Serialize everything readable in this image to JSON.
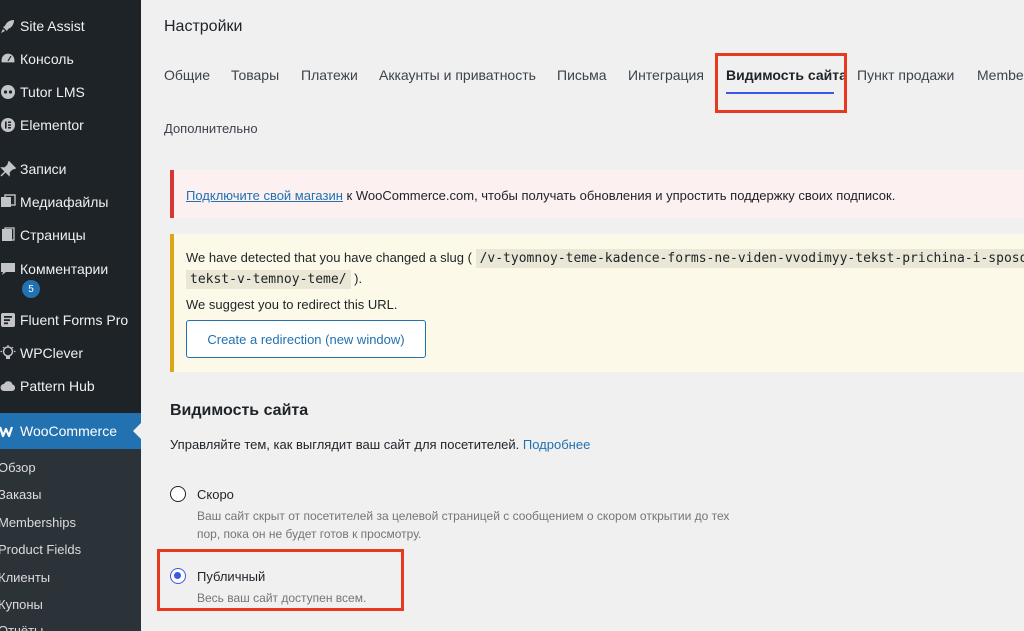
{
  "sidebar": {
    "items": [
      {
        "label": "Site Assist",
        "icon": "rocket-icon"
      },
      {
        "label": "Консоль",
        "icon": "dashboard-icon"
      },
      {
        "label": "Tutor LMS",
        "icon": "tutor-icon"
      },
      {
        "label": "Elementor",
        "icon": "elementor-icon"
      },
      {
        "label": "Записи",
        "icon": "pin-icon"
      },
      {
        "label": "Медиафайлы",
        "icon": "media-icon"
      },
      {
        "label": "Страницы",
        "icon": "page-icon"
      },
      {
        "label": "Комментарии",
        "icon": "comment-icon"
      },
      {
        "label": "Fluent Forms Pro",
        "icon": "forms-icon"
      },
      {
        "label": "WPClever",
        "icon": "bulb-icon"
      },
      {
        "label": "Pattern Hub",
        "icon": "cloud-icon"
      }
    ],
    "comments_badge": "5",
    "active": {
      "label": "WooCommerce",
      "icon": "woo-icon"
    },
    "submenu": [
      "Обзор",
      "Заказы",
      "Memberships",
      "Product Fields",
      "Клиенты",
      "Купоны",
      "Отчёты"
    ]
  },
  "page": {
    "title": "Настройки",
    "tabs": [
      "Общие",
      "Товары",
      "Платежи",
      "Аккаунты и приватность",
      "Письма",
      "Интеграция",
      "Видимость сайта",
      "Пункт продажи",
      "Membe",
      "Дополнительно"
    ],
    "active_tab": "Видимость сайта"
  },
  "notices": {
    "connect": {
      "link": "Подключите свой магазин",
      "text": " к WooCommerce.com, чтобы получать обновления и упростить поддержку своих подписок."
    },
    "slug": {
      "line1_prefix": "We have detected that you have changed a slug ( ",
      "slug_part1": "/v-tyomnoy-teme-kadence-forms-ne-viden-vvodimyy-tekst-prichina-i-sposoby",
      "slug_part2": "tekst-v-temnoy-teme/",
      "line2_suffix": " ).",
      "line3": "We suggest you to redirect this URL.",
      "button": "Create a redirection (new window)"
    }
  },
  "visibility": {
    "title": "Видимость сайта",
    "desc": "Управляйте тем, как выглядит ваш сайт для посетителей. ",
    "more_link": "Подробнее",
    "options": [
      {
        "label": "Скоро",
        "help_line1": "Ваш сайт скрыт от посетителей за целевой страницей с сообщением о скором открытии до тех",
        "help_line2": "пор, пока он не будет готов к просмотру.",
        "selected": false
      },
      {
        "label": "Публичный",
        "help_line1": "Весь ваш сайт доступен всем.",
        "selected": true
      }
    ]
  },
  "colors": {
    "accent": "#3858e9",
    "highlight": "#e6391f",
    "sidebar_bg": "#1d2327",
    "active_bg": "#2271b1"
  }
}
